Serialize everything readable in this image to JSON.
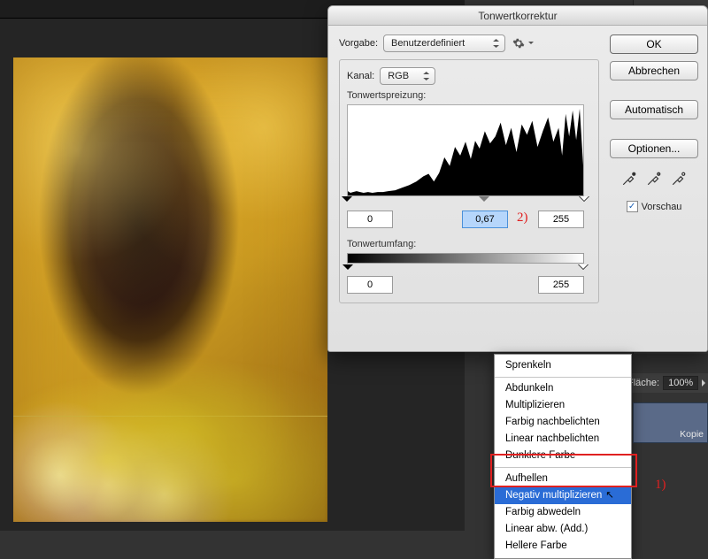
{
  "canvas": {
    "background": "#252525"
  },
  "dialog": {
    "title": "Tonwertkorrektur",
    "preset_label": "Vorgabe:",
    "preset_value": "Benutzerdefiniert",
    "buttons": {
      "ok": "OK",
      "cancel": "Abbrechen",
      "auto": "Automatisch",
      "options": "Optionen..."
    },
    "channel_label": "Kanal:",
    "channel_value": "RGB",
    "input_levels_label": "Tonwertspreizung:",
    "input_levels": {
      "black": "0",
      "mid": "0,67",
      "white": "255",
      "gray_slider_pos_pct": 58
    },
    "output_levels_label": "Tonwertumfang:",
    "output_levels": {
      "black": "0",
      "white": "255"
    },
    "preview_label": "Vorschau",
    "preview_checked": true
  },
  "annotations": {
    "step1": "1)",
    "step2": "2)"
  },
  "blend_menu": {
    "group_top": [
      "Sprenkeln"
    ],
    "group_darken": [
      "Abdunkeln",
      "Multiplizieren",
      "Farbig nachbelichten",
      "Linear nachbelichten",
      "Dunklere Farbe"
    ],
    "group_lighten": [
      "Aufhellen",
      "Negativ multiplizieren",
      "Farbig abwedeln",
      "Linear abw. (Add.)",
      "Hellere Farbe"
    ],
    "highlighted": "Negativ multiplizieren"
  },
  "layers_panel": {
    "fill_label": "Fläche:",
    "fill_value": "100%",
    "layer_name": "Kopie"
  }
}
